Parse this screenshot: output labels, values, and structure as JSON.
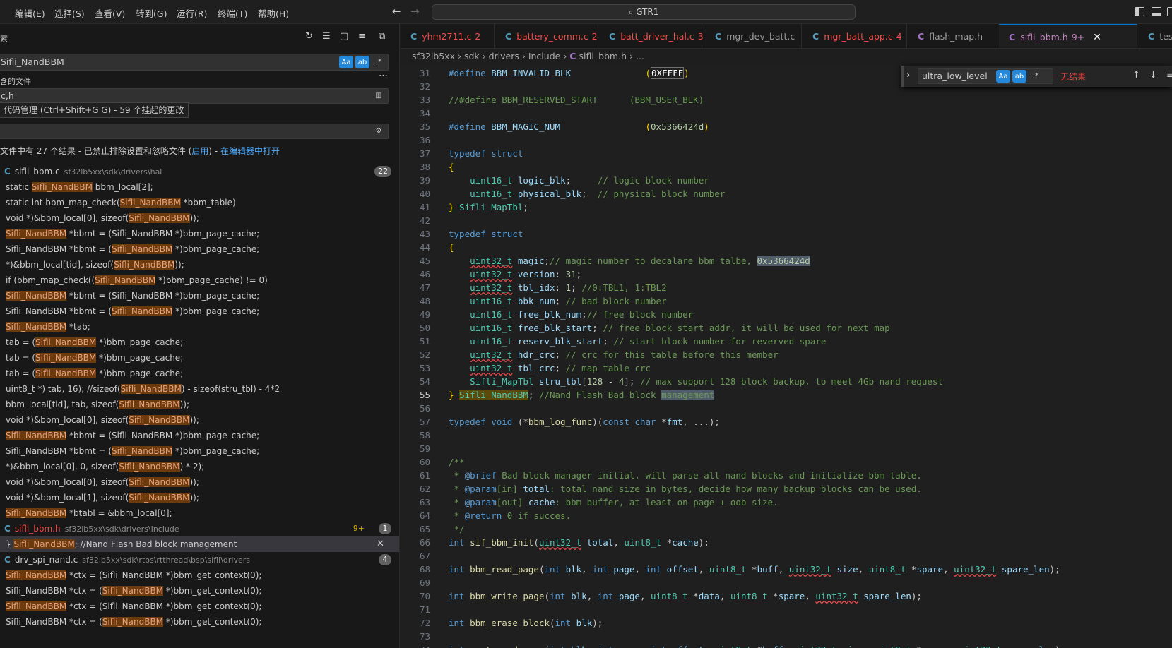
{
  "menu": [
    "编辑(E)",
    "选择(S)",
    "查看(V)",
    "转到(G)",
    "运行(R)",
    "终端(T)",
    "帮助(H)"
  ],
  "command_center": {
    "icon": "search-icon",
    "label": "GTR1"
  },
  "sidebar": {
    "title": "索",
    "search_value": "Sifli_NandBBM",
    "include_label": "含的文件",
    "include_value": "c,h",
    "tooltip": "代码管理 (Ctrl+Shift+G G) - 59 个挂起的更改",
    "summary": {
      "text": "文件中有 27 个结果 - 已禁止排除设置和忽略文件 (",
      "link_enable": "启用",
      "close_paren": ")",
      "link_open": "在编辑器中打开"
    },
    "option_labels": {
      "case": "Aa",
      "word": "ab",
      "regex": ".*"
    }
  },
  "results": [
    {
      "kind": "file",
      "icon": "C",
      "name": "sifli_bbm.c",
      "path": "sf32lb5xx\\sdk\\drivers\\hal",
      "count": "22",
      "error": false
    },
    {
      "kind": "match",
      "pre": "static ",
      "hl": "Sifli_NandBBM",
      "post": " bbm_local[2];"
    },
    {
      "kind": "match",
      "pre": "static int bbm_map_check(",
      "hl": "Sifli_NandBBM",
      "post": " *bbm_table)"
    },
    {
      "kind": "match",
      "pre": "void *)&bbm_local[0], sizeof(",
      "hl": "Sifli_NandBBM",
      "post": "));"
    },
    {
      "kind": "match",
      "pre": "",
      "hl": "Sifli_NandBBM",
      "post": " *bbmt = (Sifli_NandBBM *)bbm_page_cache;"
    },
    {
      "kind": "match",
      "pre": "Sifli_NandBBM *bbmt = (",
      "hl": "Sifli_NandBBM",
      "post": " *)bbm_page_cache;"
    },
    {
      "kind": "match",
      "pre": "*)&bbm_local[tid], sizeof(",
      "hl": "Sifli_NandBBM",
      "post": "));"
    },
    {
      "kind": "match",
      "pre": "if (bbm_map_check((",
      "hl": "Sifli_NandBBM",
      "post": " *)bbm_page_cache) != 0)"
    },
    {
      "kind": "match",
      "pre": "",
      "hl": "Sifli_NandBBM",
      "post": " *bbmt = (Sifli_NandBBM *)bbm_page_cache;"
    },
    {
      "kind": "match",
      "pre": "Sifli_NandBBM *bbmt = (",
      "hl": "Sifli_NandBBM",
      "post": " *)bbm_page_cache;"
    },
    {
      "kind": "match",
      "pre": "",
      "hl": "Sifli_NandBBM",
      "post": " *tab;"
    },
    {
      "kind": "match",
      "pre": "tab = (",
      "hl": "Sifli_NandBBM",
      "post": " *)bbm_page_cache;"
    },
    {
      "kind": "match",
      "pre": "tab = (",
      "hl": "Sifli_NandBBM",
      "post": " *)bbm_page_cache;"
    },
    {
      "kind": "match",
      "pre": "tab = (",
      "hl": "Sifli_NandBBM",
      "post": " *)bbm_page_cache;"
    },
    {
      "kind": "match",
      "pre": "uint8_t *) tab, 16);   //sizeof(",
      "hl": "Sifli_NandBBM",
      "post": ") - sizeof(stru_tbl) - 4*2"
    },
    {
      "kind": "match",
      "pre": "bbm_local[tid], tab, sizeof(",
      "hl": "Sifli_NandBBM",
      "post": "));"
    },
    {
      "kind": "match",
      "pre": "void *)&bbm_local[0], sizeof(",
      "hl": "Sifli_NandBBM",
      "post": "));"
    },
    {
      "kind": "match",
      "pre": "",
      "hl": "Sifli_NandBBM",
      "post": " *bbmt = (Sifli_NandBBM *)bbm_page_cache;"
    },
    {
      "kind": "match",
      "pre": "Sifli_NandBBM *bbmt = (",
      "hl": "Sifli_NandBBM",
      "post": " *)bbm_page_cache;"
    },
    {
      "kind": "match",
      "pre": "*)&bbm_local[0], 0, sizeof(",
      "hl": "Sifli_NandBBM",
      "post": ") * 2);"
    },
    {
      "kind": "match",
      "pre": "void *)&bbm_local[0], sizeof(",
      "hl": "Sifli_NandBBM",
      "post": "));"
    },
    {
      "kind": "match",
      "pre": "void *)&bbm_local[1], sizeof(",
      "hl": "Sifli_NandBBM",
      "post": "));"
    },
    {
      "kind": "match",
      "pre": "",
      "hl": "Sifli_NandBBM",
      "post": " *btabl = &bbm_local[0];"
    },
    {
      "kind": "file",
      "icon": "C",
      "name": "sifli_bbm.h",
      "path": "sf32lb5xx\\sdk\\drivers\\Include",
      "count": "1",
      "error": true,
      "problems": "9+"
    },
    {
      "kind": "match",
      "selected": true,
      "pre": "} ",
      "hl": "Sifli_NandBBM",
      "post": "; //Nand Flash Bad block management"
    },
    {
      "kind": "file",
      "icon": "C",
      "name": "drv_spi_nand.c",
      "path": "sf32lb5xx\\sdk\\rtos\\rtthread\\bsp\\sifli\\drivers",
      "count": "4",
      "error": false
    },
    {
      "kind": "match",
      "pre": "",
      "hl": "Sifli_NandBBM",
      "post": " *ctx = (Sifli_NandBBM *)bbm_get_context(0);"
    },
    {
      "kind": "match",
      "pre": "Sifli_NandBBM *ctx = (",
      "hl": "Sifli_NandBBM",
      "post": " *)bbm_get_context(0);"
    },
    {
      "kind": "match",
      "pre": "",
      "hl": "Sifli_NandBBM",
      "post": " *ctx = (Sifli_NandBBM *)bbm_get_context(0);"
    },
    {
      "kind": "match",
      "pre": "Sifli_NandBBM *ctx = (",
      "hl": "Sifli_NandBBM",
      "post": " *)bbm_get_context(0);"
    }
  ],
  "tabs": [
    {
      "icon": "C",
      "label": "yhm2711.c",
      "badge": "2",
      "error": true,
      "active": false
    },
    {
      "icon": "C",
      "label": "battery_comm.c",
      "badge": "2",
      "error": true,
      "active": false
    },
    {
      "icon": "C",
      "label": "batt_driver_hal.c",
      "badge": "3",
      "error": true,
      "active": false
    },
    {
      "icon": "C",
      "label": "mgr_dev_batt.c",
      "badge": "",
      "error": false,
      "active": false
    },
    {
      "icon": "C",
      "label": "mgr_batt_app.c",
      "badge": "4",
      "error": true,
      "active": false
    },
    {
      "icon": "C",
      "label": "flash_map.h",
      "badge": "",
      "error": false,
      "active": false
    },
    {
      "icon": "C",
      "label": "sifli_bbm.h",
      "badge": "9+",
      "error": false,
      "active": true
    },
    {
      "icon": "C",
      "label": "test",
      "badge": "",
      "error": false,
      "active": false
    }
  ],
  "breadcrumb": [
    "sf32lb5xx",
    "sdk",
    "drivers",
    "Include",
    "sifli_bbm.h",
    "..."
  ],
  "find_widget": {
    "value": "ultra_low_level",
    "result": "无结果",
    "case_label": "Aa",
    "word_label": "ab",
    "regex_label": ".*"
  },
  "editor": {
    "current_line": "55",
    "lines": [
      {
        "n": "31",
        "html": "<span class=\"k\">#define</span> <span class=\"v\">BBM_INVALID_BLK</span>              <span class=\"p\">(</span><span class=\"n hex-box\">0XFFFF</span><span class=\"p\">)</span>"
      },
      {
        "n": "32",
        "html": ""
      },
      {
        "n": "33",
        "html": "<span class=\"c\">//#define BBM_RESERVED_START      (BBM_USER_BLK)</span>"
      },
      {
        "n": "34",
        "html": ""
      },
      {
        "n": "35",
        "html": "<span class=\"k\">#define</span> <span class=\"v\">BBM_MAGIC_NUM</span>                <span class=\"p\">(</span><span class=\"n\">0x5366424d</span><span class=\"p\">)</span>"
      },
      {
        "n": "36",
        "html": ""
      },
      {
        "n": "37",
        "html": "<span class=\"k\">typedef</span> <span class=\"k\">struct</span>"
      },
      {
        "n": "38",
        "html": "<span class=\"p\">{</span>"
      },
      {
        "n": "39",
        "html": "    <span class=\"t\">uint16_t</span> <span class=\"v\">logic_blk</span>;     <span class=\"c\">// logic block number</span>"
      },
      {
        "n": "40",
        "html": "    <span class=\"t\">uint16_t</span> <span class=\"v\">physical_blk</span>;  <span class=\"c\">// physical block number</span>"
      },
      {
        "n": "41",
        "html": "<span class=\"p\">}</span> <span class=\"t\">Sifli_MapTbl</span>;"
      },
      {
        "n": "42",
        "html": ""
      },
      {
        "n": "43",
        "html": "<span class=\"k\">typedef</span> <span class=\"k\">struct</span>"
      },
      {
        "n": "44",
        "html": "<span class=\"p\">{</span>"
      },
      {
        "n": "45",
        "html": "    <span class=\"t sq\">uint32_t</span> <span class=\"v\">magic</span>;<span class=\"c\">// magic number to decalare bbm talbe, </span><span class=\"n match-hl\">0x5366424d</span>"
      },
      {
        "n": "46",
        "html": "    <span class=\"t sq\">uint32_t</span> <span class=\"v\">version</span>: <span class=\"n\">31</span>;"
      },
      {
        "n": "47",
        "html": "    <span class=\"t sq\">uint32_t</span> <span class=\"v\">tbl_idx</span>: <span class=\"n\">1</span>; <span class=\"c\">//0:TBL1, 1:TBL2</span>"
      },
      {
        "n": "48",
        "html": "    <span class=\"t\">uint16_t</span> <span class=\"v\">bbk_num</span>; <span class=\"c\">// bad block number</span>"
      },
      {
        "n": "49",
        "html": "    <span class=\"t\">uint16_t</span> <span class=\"v\">free_blk_num</span>;<span class=\"c\">// free block number</span>"
      },
      {
        "n": "50",
        "html": "    <span class=\"t\">uint16_t</span> <span class=\"v\">free_blk_start</span>; <span class=\"c\">// free block start addr, it will be used for next map</span>"
      },
      {
        "n": "51",
        "html": "    <span class=\"t\">uint16_t</span> <span class=\"v\">reserv_blk_start</span>; <span class=\"c\">// start block number for reverved spare</span>"
      },
      {
        "n": "52",
        "html": "    <span class=\"t sq\">uint32_t</span> <span class=\"v\">hdr_crc</span>; <span class=\"c\">// crc for this table before this member</span>"
      },
      {
        "n": "53",
        "html": "    <span class=\"t sq\">uint32_t</span> <span class=\"v\">tbl_crc</span>; <span class=\"c\">// map table crc</span>"
      },
      {
        "n": "54",
        "html": "    <span class=\"t\">Sifli_MapTbl</span> <span class=\"v\">stru_tbl</span>[<span class=\"n\">128</span> - <span class=\"n\">4</span>]; <span class=\"c\">// max support 128 block backup, to meet 4Gb nand request</span>"
      },
      {
        "n": "55",
        "html": "<span class=\"p\">}</span> <span class=\"t selbg\">Sifli_NandBBM</span>; <span class=\"c\">//Nand Flash Bad block </span><span class=\"c match-hl\">management</span>"
      },
      {
        "n": "56",
        "html": ""
      },
      {
        "n": "57",
        "html": "<span class=\"k\">typedef</span> <span class=\"k\">void</span> (*<span class=\"f\">bbm_log_func</span>)(<span class=\"k\">const</span> <span class=\"k\">char</span> *<span class=\"v\">fmt</span>, ...);"
      },
      {
        "n": "58",
        "html": ""
      },
      {
        "n": "59",
        "html": ""
      },
      {
        "n": "60",
        "html": "<span class=\"c\">/**</span>"
      },
      {
        "n": "61",
        "html": "<span class=\"c\"> * </span><span class=\"k\">@brief</span><span class=\"c\"> Bad block manager initial, will parse all nand blocks and initialize bbm table.</span>"
      },
      {
        "n": "62",
        "html": "<span class=\"c\"> * </span><span class=\"k\">@param</span><span class=\"c\">[in] </span><span class=\"v\">total</span><span class=\"c\">: total nand size in bytes, decide how many backup blocks can be used.</span>"
      },
      {
        "n": "63",
        "html": "<span class=\"c\"> * </span><span class=\"k\">@param</span><span class=\"c\">[out] </span><span class=\"v\">cache</span><span class=\"c\">: bbm buffer, at least on page + oob size.</span>"
      },
      {
        "n": "64",
        "html": "<span class=\"c\"> * </span><span class=\"k\">@return</span><span class=\"c\"> 0 if succes.</span>"
      },
      {
        "n": "65",
        "html": "<span class=\"c\"> */</span>"
      },
      {
        "n": "66",
        "html": "<span class=\"k\">int</span> <span class=\"f\">sif_bbm_init</span>(<span class=\"t sq\">uint32_t</span> <span class=\"v\">total</span>, <span class=\"t\">uint8_t</span> *<span class=\"v\">cache</span>);"
      },
      {
        "n": "67",
        "html": ""
      },
      {
        "n": "68",
        "html": "<span class=\"k\">int</span> <span class=\"f\">bbm_read_page</span>(<span class=\"k\">int</span> <span class=\"v\">blk</span>, <span class=\"k\">int</span> <span class=\"v\">page</span>, <span class=\"k\">int</span> <span class=\"v\">offset</span>, <span class=\"t\">uint8_t</span> *<span class=\"v\">buff</span>, <span class=\"t sq\">uint32_t</span> <span class=\"v\">size</span>, <span class=\"t\">uint8_t</span> *<span class=\"v\">spare</span>, <span class=\"t sq\">uint32_t</span> <span class=\"v\">spare_len</span>);"
      },
      {
        "n": "69",
        "html": ""
      },
      {
        "n": "70",
        "html": "<span class=\"k\">int</span> <span class=\"f\">bbm_write_page</span>(<span class=\"k\">int</span> <span class=\"v\">blk</span>, <span class=\"k\">int</span> <span class=\"v\">page</span>, <span class=\"t\">uint8_t</span> *<span class=\"v\">data</span>, <span class=\"t\">uint8_t</span> *<span class=\"v\">spare</span>, <span class=\"t sq\">uint32_t</span> <span class=\"v\">spare_len</span>);"
      },
      {
        "n": "71",
        "html": ""
      },
      {
        "n": "72",
        "html": "<span class=\"k\">int</span> <span class=\"f\">bbm_erase_block</span>(<span class=\"k\">int</span> <span class=\"v\">blk</span>);"
      },
      {
        "n": "73",
        "html": ""
      },
      {
        "n": "74",
        "html": "<span class=\"k\">int</span> <span class=\"f\">port_read_page</span>(<span class=\"k\">int</span> <span class=\"v\">blk</span>, <span class=\"k\">int</span> <span class=\"v\">page</span>, <span class=\"k\">int</span> <span class=\"v\">offset</span>, <span class=\"t\">uint8_t</span> *<span class=\"v\">buff</span>, <span class=\"t sq\">uint32_t</span> <span class=\"v\">size</span>, <span class=\"t\">uint8_t</span> *<span class=\"v\">spare</span>, <span class=\"t sq\">uint32_t</span> <span class=\"v\">spare_len</span>);"
      }
    ]
  }
}
